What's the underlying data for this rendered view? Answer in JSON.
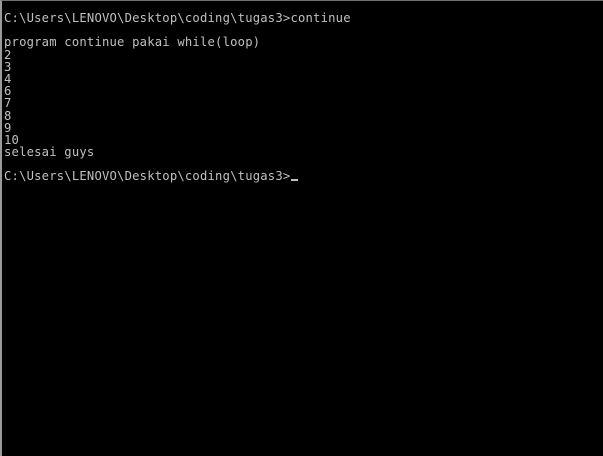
{
  "console": {
    "command_line": {
      "prompt": "C:\\Users\\LENOVO\\Desktop\\coding\\tugas3>",
      "command": "continue"
    },
    "output": {
      "header": "program continue pakai while(loop)",
      "numbers": [
        "2",
        "3",
        "4",
        "6",
        "7",
        "8",
        "9",
        "10"
      ],
      "footer": "selesai guys"
    },
    "final_prompt": "C:\\Users\\LENOVO\\Desktop\\coding\\tugas3>"
  }
}
